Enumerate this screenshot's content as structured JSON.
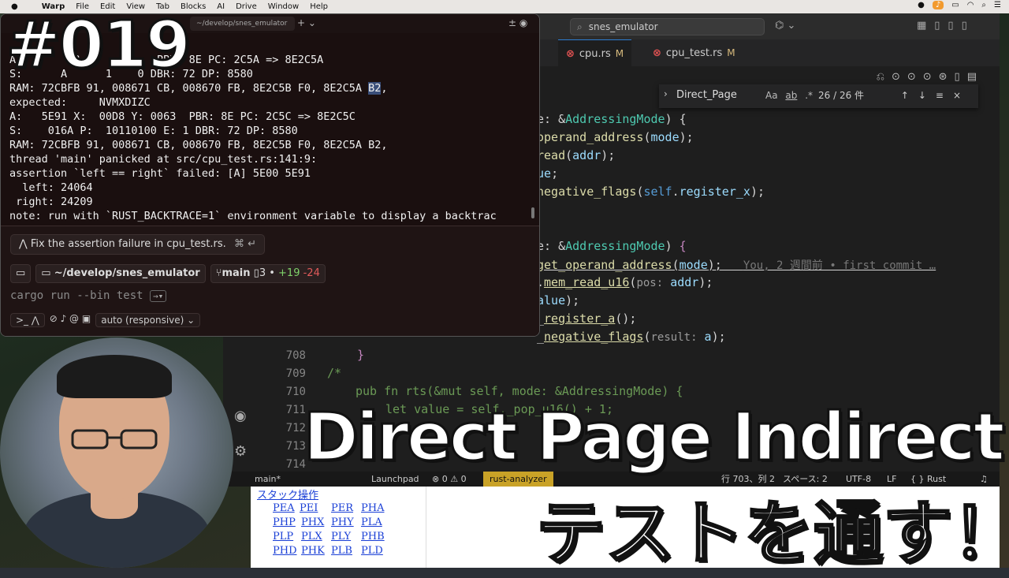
{
  "menubar": {
    "app": "Warp",
    "items": [
      "File",
      "Edit",
      "View",
      "Tab",
      "Blocks",
      "AI",
      "Drive",
      "Window",
      "Help"
    ]
  },
  "terminal": {
    "tab_title": "~/develop/snes_emulator",
    "output_lines": [
      "A:        8       0    PBR: 8E PC: 2C5A => 8E2C5A",
      "S:      A      1    0 DBR: 72 DP: 8580",
      "RAM: 72CBFB 91, 008671 CB, 008670 FB, 8E2C5B F0, 8E2C5A ",
      "expected:     NVMXDIZC",
      "A:   5E91 X:  00D8 Y: 0063  PBR: 8E PC: 2C5C => 8E2C5C",
      "S:    016A P:  10110100 E: 1 DBR: 72 DP: 8580",
      "RAM: 72CBFB 91, 008671 CB, 008670 FB, 8E2C5B F0, 8E2C5A B2,",
      "thread 'main' panicked at src/cpu_test.rs:141:9:",
      "assertion `left == right` failed: [A] 5E00 5E91",
      "  left: 24064",
      " right: 24209",
      "note: run with `RUST_BACKTRACE=1` environment variable to display a backtrac"
    ],
    "highlighted": "B2",
    "ai_suggestion": "Fix the assertion failure in cpu_test.rs.",
    "ai_shortcut": "⌘ ↵",
    "cwd": "~/develop/snes_emulator",
    "branch": "main",
    "files_changed": "3",
    "additions": "+19",
    "deletions": "-24",
    "command_placeholder": "cargo run --bin test",
    "mode": "auto (responsive)"
  },
  "vscode": {
    "search": "snes_emulator",
    "tabs": [
      {
        "label": "cpu.rs",
        "modified": "M"
      },
      {
        "label": "cpu_test.rs",
        "modified": "M"
      }
    ],
    "find": {
      "query": "Direct_Page",
      "opt_case": "Aa",
      "opt_word": "ab",
      "opt_regex": ".*",
      "count": "26 / 26 件"
    },
    "line_numbers": [
      "708",
      "709",
      "710",
      "711",
      "712",
      "713",
      "714"
    ],
    "blame": "You, 2 週間前 • first commit …",
    "status": {
      "branch": "main*",
      "launchpad": "Launchpad",
      "problems": "⊗ 0 ⚠ 0",
      "analyzer": "rust-analyzer",
      "position": "行 703、列 2",
      "spaces": "スペース: 2",
      "encoding": "UTF-8",
      "eol": "LF",
      "language": "{ } Rust"
    }
  },
  "doc": {
    "heading": "スタック操作",
    "links": [
      [
        "PEA",
        "PEI",
        "PER",
        "PHA"
      ],
      [
        "PHP",
        "PHX",
        "PHY",
        "PLA"
      ],
      [
        "PLP",
        "PLX",
        "PLY",
        "PHB"
      ],
      [
        "PHD",
        "PHK",
        "PLB",
        "PLD"
      ]
    ]
  },
  "overlay": {
    "episode": "#019",
    "title_line1": "Direct Page Indirect",
    "title_line2": "テストを通す！"
  },
  "colors": {
    "accent": "#2d7dd2",
    "analyzer_bg": "#c9a227"
  }
}
